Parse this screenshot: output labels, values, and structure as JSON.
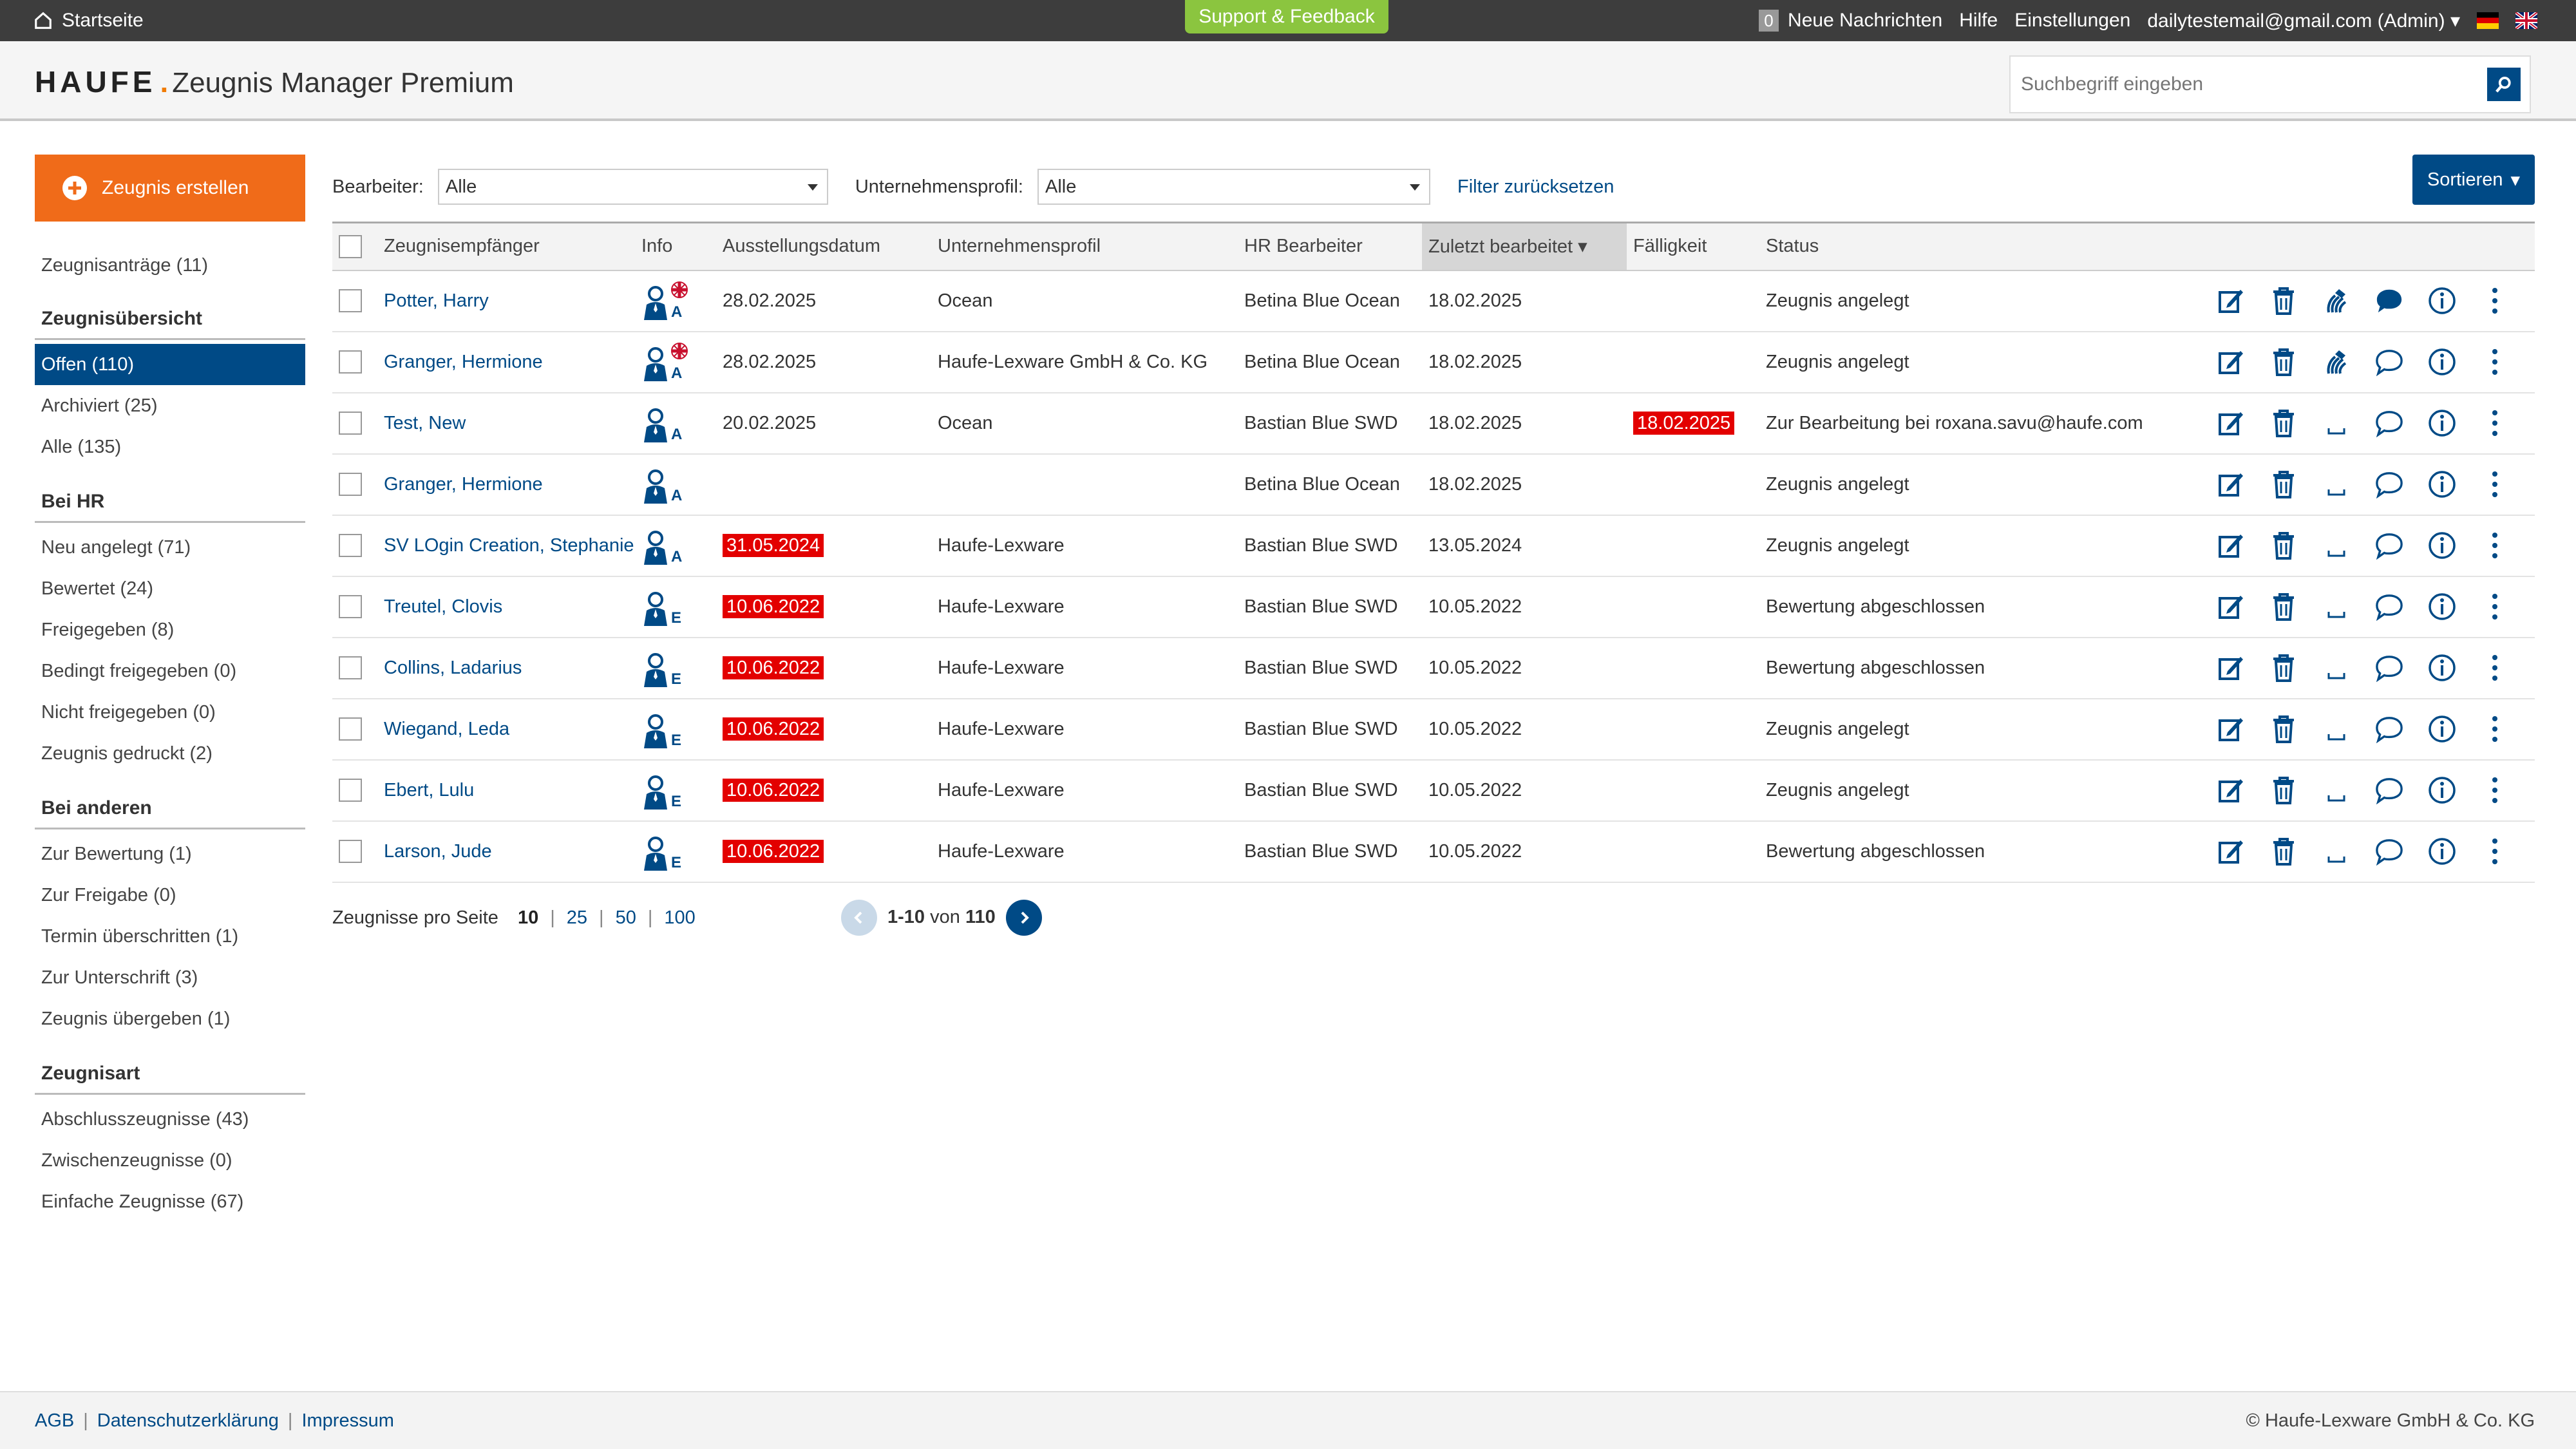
{
  "topbar": {
    "home_label": "Startseite",
    "support_label": "Support & Feedback",
    "message_count": "0",
    "messages_label": "Neue Nachrichten",
    "help_label": "Hilfe",
    "settings_label": "Einstellungen",
    "user_label": "dailytestemail@gmail.com (Admin)"
  },
  "header": {
    "brand": "HAUFE",
    "brand_dot": ".",
    "product": "Zeugnis Manager Premium",
    "search_placeholder": "Suchbegriff eingeben"
  },
  "sidebar": {
    "create_label": "Zeugnis erstellen",
    "requests": "Zeugnisanträge (11)",
    "sections": [
      {
        "title": "Zeugnisübersicht",
        "items": [
          "Offen (110)",
          "Archiviert (25)",
          "Alle (135)"
        ]
      },
      {
        "title": "Bei HR",
        "items": [
          "Neu angelegt (71)",
          "Bewertet (24)",
          "Freigegeben (8)",
          "Bedingt freigegeben (0)",
          "Nicht freigegeben (0)",
          "Zeugnis gedruckt (2)"
        ]
      },
      {
        "title": "Bei anderen",
        "items": [
          "Zur Bewertung (1)",
          "Zur Freigabe (0)",
          "Termin überschritten (1)",
          "Zur Unterschrift (3)",
          "Zeugnis übergeben (1)"
        ]
      },
      {
        "title": "Zeugnisart",
        "items": [
          "Abschlusszeugnisse (43)",
          "Zwischenzeugnisse (0)",
          "Einfache Zeugnisse (67)"
        ]
      }
    ]
  },
  "filters": {
    "editor_label": "Bearbeiter:",
    "editor_value": "Alle",
    "profile_label": "Unternehmensprofil:",
    "profile_value": "Alle",
    "reset_label": "Filter zurücksetzen",
    "sort_label": "Sortieren"
  },
  "table": {
    "headers": [
      "Zeugnisempfänger",
      "Info",
      "Ausstellungsdatum",
      "Unternehmensprofil",
      "HR Bearbeiter",
      "Zuletzt bearbeitet",
      "Fälligkeit",
      "Status"
    ],
    "rows": [
      {
        "name": "Potter, Harry",
        "letter": "A",
        "flag": true,
        "date": "28.02.2025",
        "date_overdue": false,
        "profile": "Ocean",
        "hr": "Betina Blue Ocean",
        "edited": "18.02.2025",
        "due": "",
        "status": "Zeugnis angelegt",
        "sign": true,
        "comment_filled": true
      },
      {
        "name": "Granger, Hermione",
        "letter": "A",
        "flag": true,
        "date": "28.02.2025",
        "date_overdue": false,
        "profile": "Haufe-Lexware GmbH & Co. KG",
        "hr": "Betina Blue Ocean",
        "edited": "18.02.2025",
        "due": "",
        "status": "Zeugnis angelegt",
        "sign": true,
        "comment_filled": false
      },
      {
        "name": "Test, New",
        "letter": "A",
        "flag": false,
        "date": "20.02.2025",
        "date_overdue": false,
        "profile": "Ocean",
        "hr": "Bastian Blue SWD",
        "edited": "18.02.2025",
        "due": "18.02.2025",
        "status": "Zur Bearbeitung bei roxana.savu@haufe.com",
        "sign": false,
        "comment_filled": false
      },
      {
        "name": "Granger, Hermione",
        "letter": "A",
        "flag": false,
        "date": "",
        "date_overdue": false,
        "profile": "",
        "hr": "Betina Blue Ocean",
        "edited": "18.02.2025",
        "due": "",
        "status": "Zeugnis angelegt",
        "sign": false,
        "comment_filled": false
      },
      {
        "name": "SV LOgin Creation, Stephanie",
        "letter": "A",
        "flag": false,
        "date": "31.05.2024",
        "date_overdue": true,
        "profile": "Haufe-Lexware",
        "hr": "Bastian Blue SWD",
        "edited": "13.05.2024",
        "due": "",
        "status": "Zeugnis angelegt",
        "sign": false,
        "comment_filled": false
      },
      {
        "name": "Treutel, Clovis",
        "letter": "E",
        "flag": false,
        "date": "10.06.2022",
        "date_overdue": true,
        "profile": "Haufe-Lexware",
        "hr": "Bastian Blue SWD",
        "edited": "10.05.2022",
        "due": "",
        "status": "Bewertung abgeschlossen",
        "sign": false,
        "comment_filled": false
      },
      {
        "name": "Collins, Ladarius",
        "letter": "E",
        "flag": false,
        "date": "10.06.2022",
        "date_overdue": true,
        "profile": "Haufe-Lexware",
        "hr": "Bastian Blue SWD",
        "edited": "10.05.2022",
        "due": "",
        "status": "Bewertung abgeschlossen",
        "sign": false,
        "comment_filled": false
      },
      {
        "name": "Wiegand, Leda",
        "letter": "E",
        "flag": false,
        "date": "10.06.2022",
        "date_overdue": true,
        "profile": "Haufe-Lexware",
        "hr": "Bastian Blue SWD",
        "edited": "10.05.2022",
        "due": "",
        "status": "Zeugnis angelegt",
        "sign": false,
        "comment_filled": false
      },
      {
        "name": "Ebert, Lulu",
        "letter": "E",
        "flag": false,
        "date": "10.06.2022",
        "date_overdue": true,
        "profile": "Haufe-Lexware",
        "hr": "Bastian Blue SWD",
        "edited": "10.05.2022",
        "due": "",
        "status": "Zeugnis angelegt",
        "sign": false,
        "comment_filled": false
      },
      {
        "name": "Larson, Jude",
        "letter": "E",
        "flag": false,
        "date": "10.06.2022",
        "date_overdue": true,
        "profile": "Haufe-Lexware",
        "hr": "Bastian Blue SWD",
        "edited": "10.05.2022",
        "due": "",
        "status": "Bewertung abgeschlossen",
        "sign": false,
        "comment_filled": false
      }
    ]
  },
  "pagination": {
    "per_page_label": "Zeugnisse pro Seite",
    "options": [
      "10",
      "25",
      "50",
      "100"
    ],
    "current_option": "10",
    "range": "1-10",
    "of_label": "von",
    "total": "110"
  },
  "footer": {
    "links": [
      "AGB",
      "Datenschutzerklärung",
      "Impressum"
    ],
    "copyright": "© Haufe-Lexware GmbH & Co. KG"
  },
  "colors": {
    "accent": "#004a86",
    "create_button": "#f06b19",
    "support": "#8bc53f",
    "overdue": "#e30000"
  }
}
